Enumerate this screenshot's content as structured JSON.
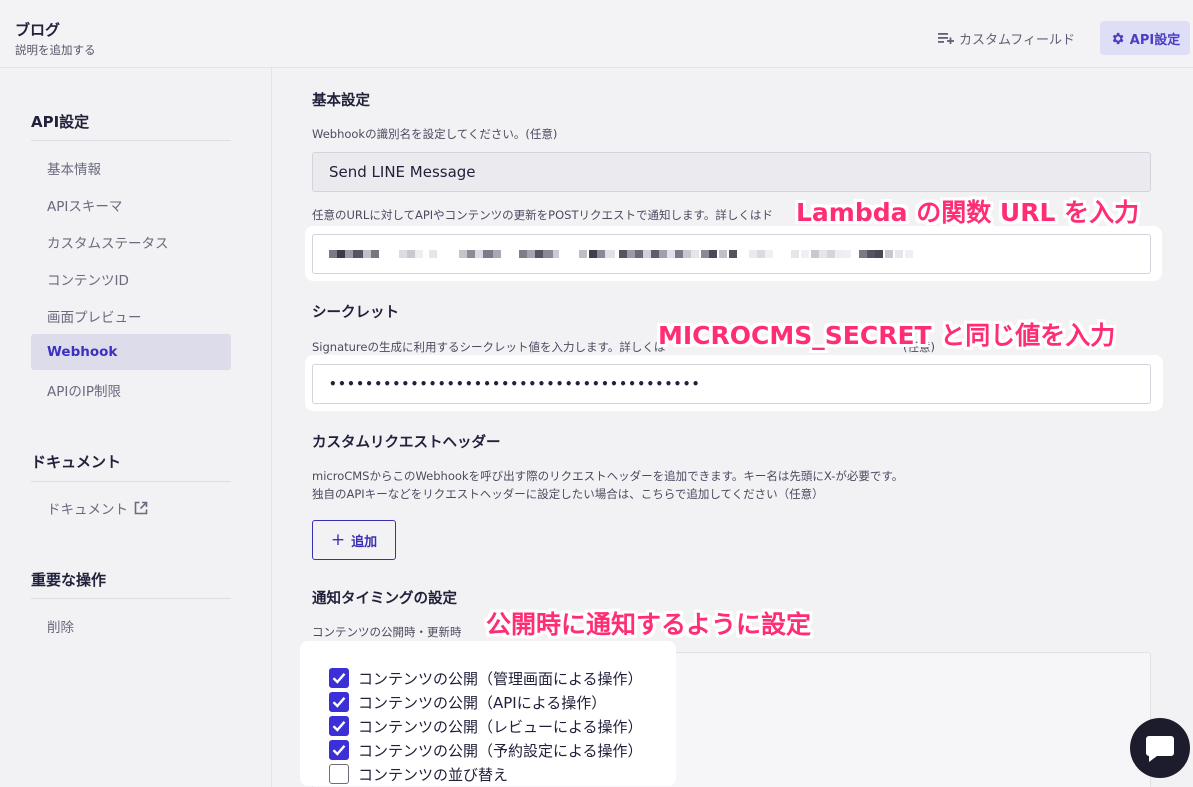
{
  "header": {
    "title": "ブログ",
    "subtitle": "説明を追加する",
    "custom_field_label": "カスタムフィールド",
    "api_settings_label": "API設定",
    "accent": "#4a3fc4"
  },
  "sidebar": {
    "api_heading": "API設定",
    "items": [
      {
        "label": "基本情報"
      },
      {
        "label": "APIスキーマ"
      },
      {
        "label": "カスタムステータス"
      },
      {
        "label": "コンテンツID"
      },
      {
        "label": "画面プレビュー"
      },
      {
        "label": "Webhook"
      },
      {
        "label": "APIのIP制限"
      }
    ],
    "active_item": "Webhook",
    "doc_heading": "ドキュメント",
    "doc_item": "ドキュメント",
    "danger_heading": "重要な操作",
    "delete_item": "削除"
  },
  "main": {
    "basic_title": "基本設定",
    "name_desc": "Webhookの識別名を設定してください。(任意)",
    "name_value": "Send LINE Message",
    "url_desc": "任意のURLに対してAPIやコンテンツの更新をPOSTリクエストで通知します。詳しくはド",
    "secret_title": "シークレット",
    "secret_desc": "Signatureの生成に利用するシークレット値を入力します。詳しくは",
    "secret_desc_tail": "(任意)",
    "secret_value": "•••••••••••••••••••••••••••••••••••••••••",
    "header_title": "カスタムリクエストヘッダー",
    "header_desc1": "microCMSからこのWebhookを呼び出す際のリクエストヘッダーを追加できます。キー名は先頭にX-が必要です。",
    "header_desc2": "独自のAPIキーなどをリクエストヘッダーに設定したい場合は、こちらで追加してください（任意）",
    "add_label": "追加",
    "timing_title": "通知タイミングの設定",
    "timing_desc": "コンテンツの公開時・更新時",
    "checkboxes": [
      {
        "label": "コンテンツの公開（管理画面による操作）",
        "checked": true
      },
      {
        "label": "コンテンツの公開（APIによる操作）",
        "checked": true
      },
      {
        "label": "コンテンツの公開（レビューによる操作）",
        "checked": true
      },
      {
        "label": "コンテンツの公開（予約設定による操作）",
        "checked": true
      },
      {
        "label": "コンテンツの並び替え",
        "checked": false
      }
    ]
  },
  "callouts": {
    "lambda": "Lambda の関数 URL を入力",
    "secret": "MICROCMS_SECRET と同じ値を入力",
    "publish": "公開時に通知するように設定",
    "color": "#ff2e74"
  }
}
